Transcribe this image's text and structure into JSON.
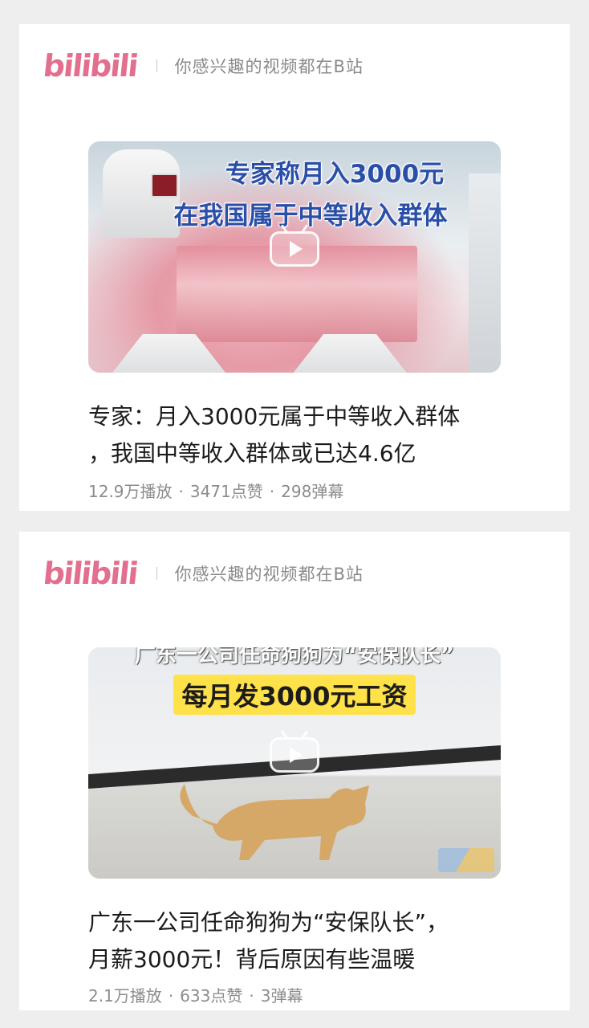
{
  "brand": {
    "logo": "bilibili",
    "slogan": "你感兴趣的视频都在B站",
    "color": "#e36f8f"
  },
  "cards": [
    {
      "thumbnail_overlay": [
        "专家称月入3000元",
        "在我国属于中等收入群体"
      ],
      "title_line1": "专家：月入3000元属于中等收入群体",
      "title_line2": "，我国中等收入群体或已达4.6亿",
      "views": "12.9万播放",
      "likes": "3471点赞",
      "danmaku": "298弹幕"
    },
    {
      "thumbnail_overlay": [
        "广东一公司任命狗狗为“安保队长”",
        "每月发3000元工资"
      ],
      "title_line1": "广东一公司任命狗狗为“安保队长”，",
      "title_line2": "月薪3000元！背后原因有些温暖",
      "views": "2.1万播放",
      "likes": "633点赞",
      "danmaku": "3弹幕"
    }
  ],
  "separator": "·",
  "icons": [
    "play-icon"
  ]
}
